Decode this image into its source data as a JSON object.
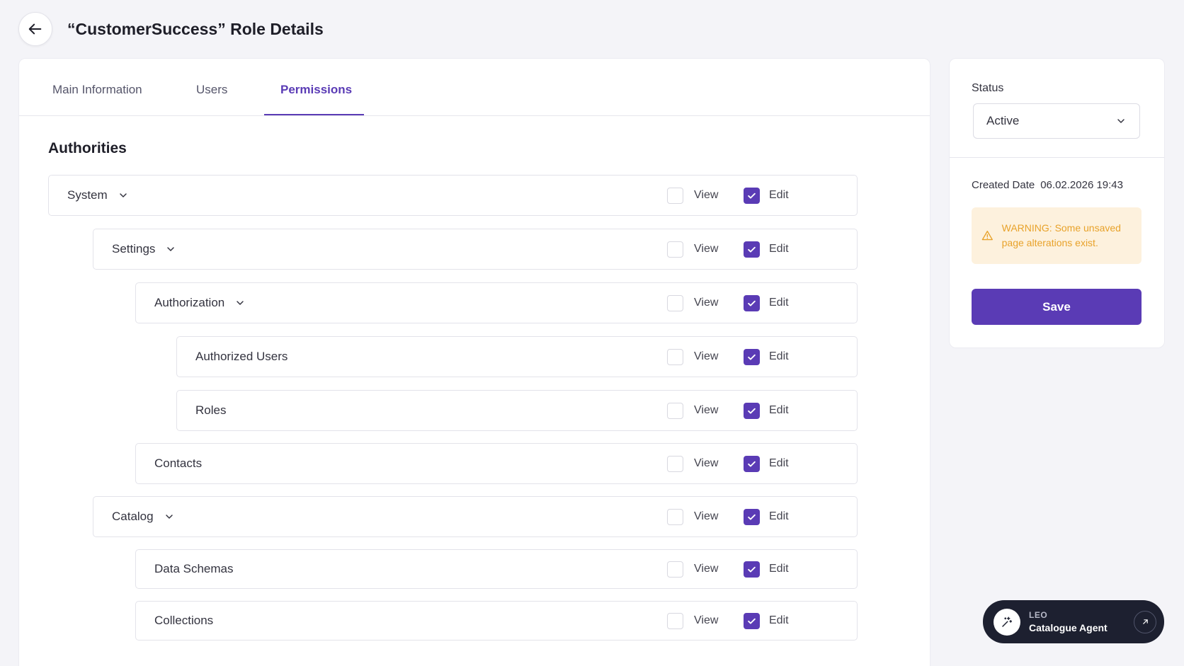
{
  "header": {
    "title": "“CustomerSuccess” Role Details"
  },
  "tabs": [
    {
      "label": "Main Information",
      "active": false
    },
    {
      "label": "Users",
      "active": false
    },
    {
      "label": "Permissions",
      "active": true
    }
  ],
  "authorities": {
    "title": "Authorities",
    "view_label": "View",
    "edit_label": "Edit",
    "rows": [
      {
        "label": "System",
        "expandable": true,
        "view": false,
        "edit": true
      },
      {
        "label": "Settings",
        "expandable": true,
        "view": false,
        "edit": true
      },
      {
        "label": "Authorization",
        "expandable": true,
        "view": false,
        "edit": true
      },
      {
        "label": "Authorized Users",
        "expandable": false,
        "view": false,
        "edit": true
      },
      {
        "label": "Roles",
        "expandable": false,
        "view": false,
        "edit": true
      },
      {
        "label": "Contacts",
        "expandable": false,
        "view": false,
        "edit": true
      },
      {
        "label": "Catalog",
        "expandable": true,
        "view": false,
        "edit": true
      },
      {
        "label": "Data Schemas",
        "expandable": false,
        "view": false,
        "edit": true
      },
      {
        "label": "Collections",
        "expandable": false,
        "view": false,
        "edit": true
      }
    ]
  },
  "sidebar": {
    "status_label": "Status",
    "status_value": "Active",
    "created_label": "Created Date",
    "created_value": "06.02.2026 19:43",
    "warning": "WARNING: Some unsaved page alterations exist.",
    "save_label": "Save"
  },
  "agent": {
    "kicker": "LEO",
    "name": "Catalogue Agent"
  },
  "colors": {
    "accent": "#5a3bb5",
    "warning_bg": "#fdf1dd",
    "warning_text": "#e8a22a",
    "agent_bg": "#1d2030"
  }
}
